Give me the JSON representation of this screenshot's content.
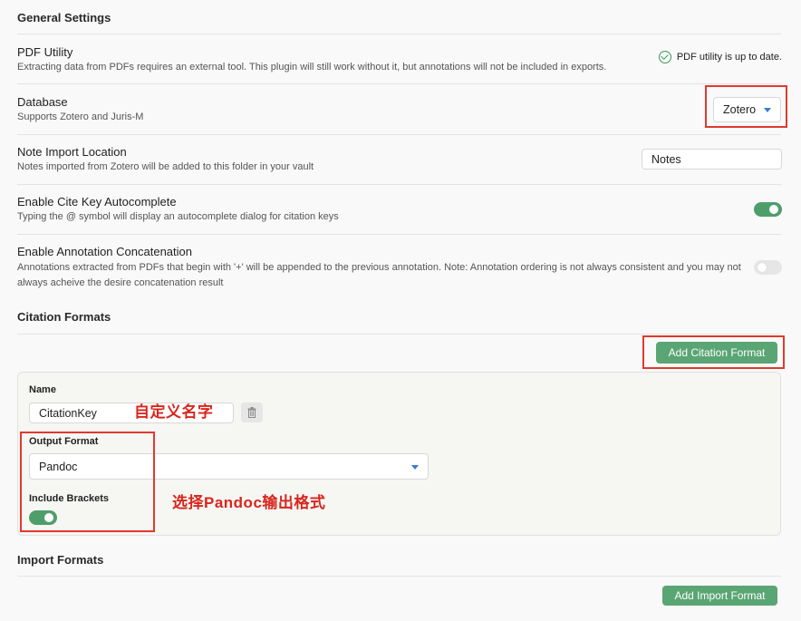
{
  "general": {
    "title": "General Settings"
  },
  "pdf_utility": {
    "name": "PDF Utility",
    "desc": "Extracting data from PDFs requires an external tool. This plugin will still work without it, but annotations will not be included in exports.",
    "status": "PDF utility is up to date.",
    "status_icon": "check-circle-icon"
  },
  "database": {
    "name": "Database",
    "desc": "Supports Zotero and Juris-M",
    "selected": "Zotero"
  },
  "note_import": {
    "name": "Note Import Location",
    "desc": "Notes imported from Zotero will be added to this folder in your vault",
    "value": "Notes"
  },
  "cite_key": {
    "name": "Enable Cite Key Autocomplete",
    "desc": "Typing the @ symbol will display an autocomplete dialog for citation keys",
    "enabled": true
  },
  "annotation_concat": {
    "name": "Enable Annotation Concatenation",
    "desc": "Annotations extracted from PDFs that begin with '+' will be appended to the previous annotation. Note: Annotation ordering is not always consistent and you may not always acheive the desire concatenation result",
    "enabled": false
  },
  "citation_formats": {
    "title": "Citation Formats",
    "add_label": "Add Citation Format",
    "format": {
      "name_label": "Name",
      "name_value": "CitationKey",
      "output_label": "Output Format",
      "output_value": "Pandoc",
      "brackets_label": "Include Brackets",
      "brackets_enabled": true
    }
  },
  "import_formats": {
    "title": "Import Formats",
    "add_label": "Add Import Format"
  },
  "annotations": {
    "name_note": "自定义名字",
    "format_note": "选择Pandoc输出格式"
  },
  "colors": {
    "accent": "#5aa574",
    "highlight": "#e03a2e",
    "dropdown_caret": "#3a7bd5"
  }
}
